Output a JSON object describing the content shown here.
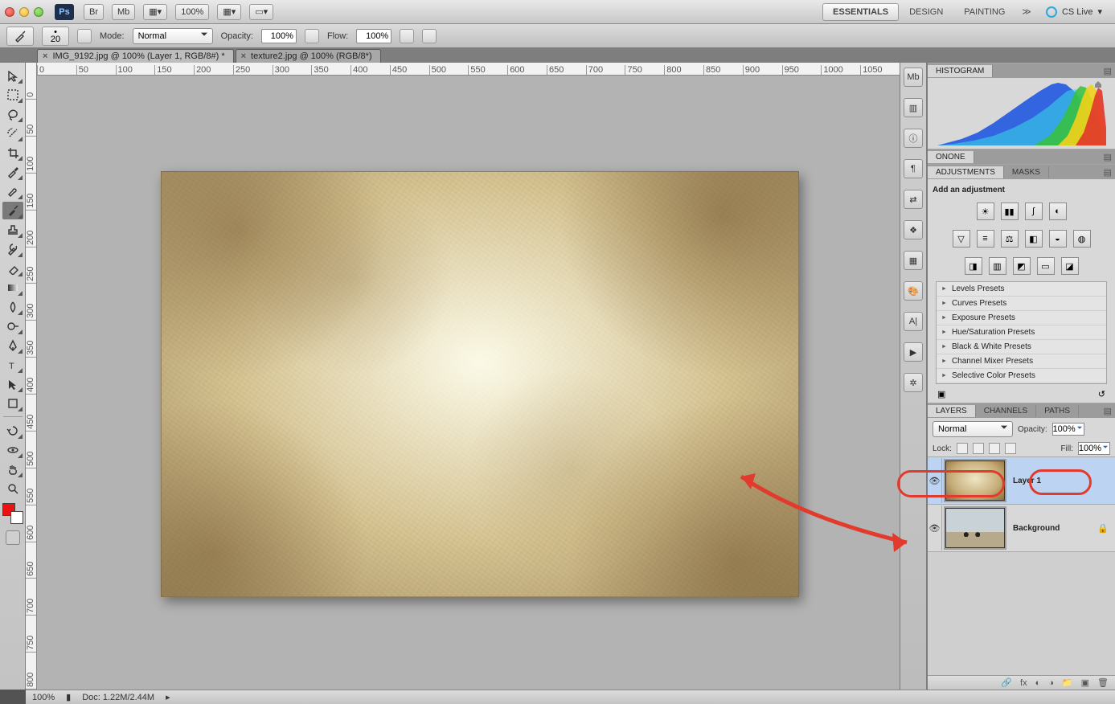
{
  "app": {
    "ps": "Ps",
    "zoom": "100%",
    "br": "Br",
    "mb": "Mb"
  },
  "workspaces": {
    "active": "ESSENTIALS",
    "design": "DESIGN",
    "painting": "PAINTING",
    "cslive": "CS Live"
  },
  "options": {
    "brush_size": "20",
    "mode_label": "Mode:",
    "mode_value": "Normal",
    "opacity_label": "Opacity:",
    "opacity_value": "100%",
    "flow_label": "Flow:",
    "flow_value": "100%"
  },
  "tabs": [
    {
      "label": "IMG_9192.jpg @ 100% (Layer 1, RGB/8#) *",
      "active": true
    },
    {
      "label": "texture2.jpg @ 100% (RGB/8*)",
      "active": false
    }
  ],
  "ruler_h": [
    "0",
    "50",
    "100",
    "150",
    "200",
    "250",
    "300",
    "350",
    "400",
    "450",
    "500",
    "550",
    "600",
    "650",
    "700",
    "750",
    "800",
    "850",
    "900",
    "950",
    "1000",
    "1050"
  ],
  "ruler_v": [
    "0",
    "50",
    "100",
    "150",
    "200",
    "250",
    "300",
    "350",
    "400",
    "450",
    "500",
    "550",
    "600",
    "650",
    "700",
    "750",
    "800"
  ],
  "panels": {
    "histogram": "HISTOGRAM",
    "onone": "ONONE",
    "adjustments": "ADJUSTMENTS",
    "masks": "MASKS",
    "add_adjustment": "Add an adjustment",
    "presets": [
      "Levels Presets",
      "Curves Presets",
      "Exposure Presets",
      "Hue/Saturation Presets",
      "Black & White Presets",
      "Channel Mixer Presets",
      "Selective Color Presets"
    ],
    "layers": "LAYERS",
    "channels": "CHANNELS",
    "paths": "PATHS"
  },
  "layers_panel": {
    "blend": "Normal",
    "opacity_label": "Opacity:",
    "opacity_value": "100%",
    "lock_label": "Lock:",
    "fill_label": "Fill:",
    "fill_value": "100%",
    "layers": [
      {
        "name": "Layer 1"
      },
      {
        "name": "Background"
      }
    ]
  },
  "status": {
    "zoom": "100%",
    "doc": "Doc: 1.22M/2.44M"
  }
}
